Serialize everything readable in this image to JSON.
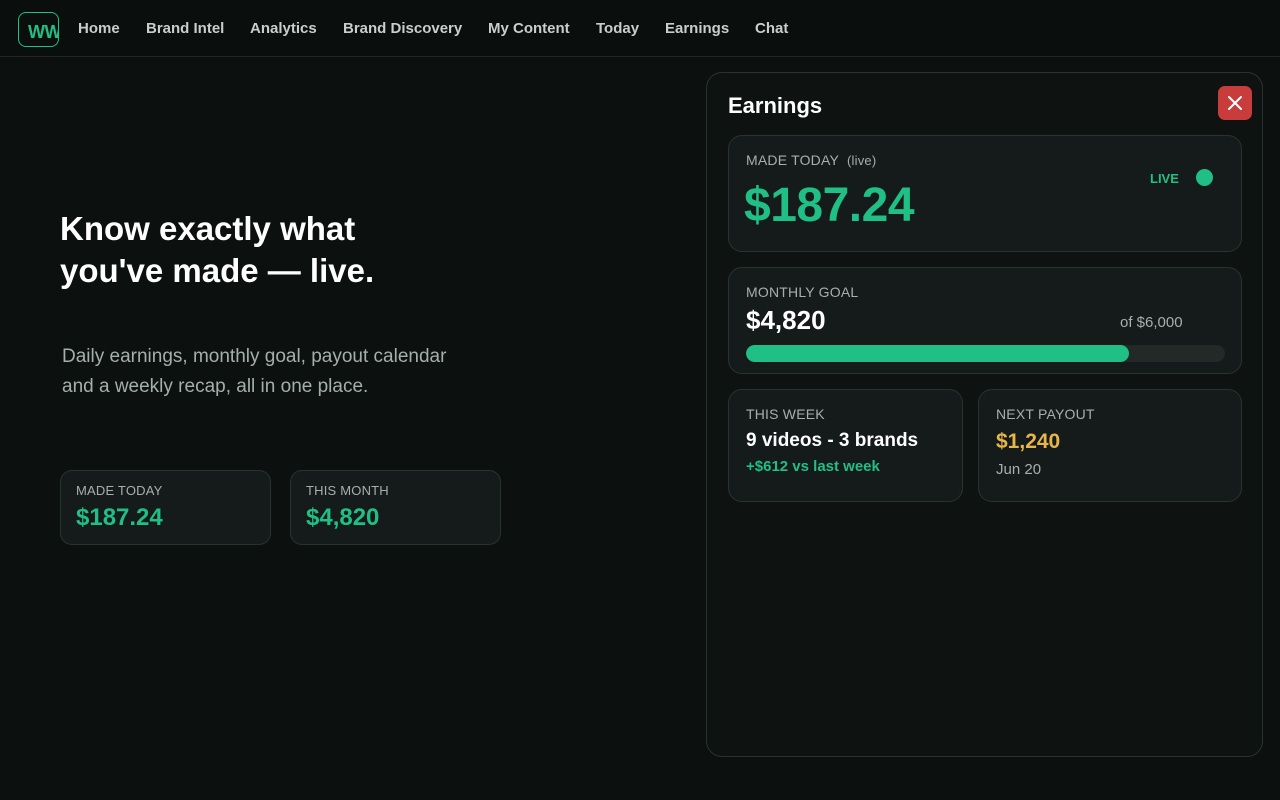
{
  "nav": {
    "logo": "WW",
    "items": [
      {
        "label": "Home"
      },
      {
        "label": "Brand Intel"
      },
      {
        "label": "Analytics"
      },
      {
        "label": "Brand Discovery"
      },
      {
        "label": "My Content"
      },
      {
        "label": "Today"
      },
      {
        "label": "Earnings"
      },
      {
        "label": "Chat"
      }
    ]
  },
  "hero": {
    "title": "Know exactly what you've made — live.",
    "subtitle": "Daily earnings, monthly goal, payout calendar and a weekly recap, all in one place.",
    "cards": [
      {
        "label": "MADE TODAY",
        "value": "$187.24"
      },
      {
        "label": "THIS MONTH",
        "value": "$4,820"
      }
    ]
  },
  "panel": {
    "title": "Earnings",
    "close_icon": "close-icon",
    "today": {
      "label": "MADE TODAY",
      "label_suffix": "(live)",
      "value": "$187.24",
      "live_badge": "LIVE"
    },
    "goal": {
      "label": "MONTHLY GOAL",
      "value": "$4,820",
      "of_text": "of $6,000",
      "progress_fraction": 0.8
    },
    "week": {
      "label": "THIS WEEK",
      "summary": "9 videos - 3 brands",
      "delta": "+$612 vs last week"
    },
    "payout": {
      "label": "NEXT PAYOUT",
      "amount": "$1,240",
      "date": "Jun 20"
    }
  },
  "colors": {
    "accent": "#1fbf85",
    "payout": "#e8b54a",
    "close": "#c93c3c",
    "background": "#0c1110"
  }
}
